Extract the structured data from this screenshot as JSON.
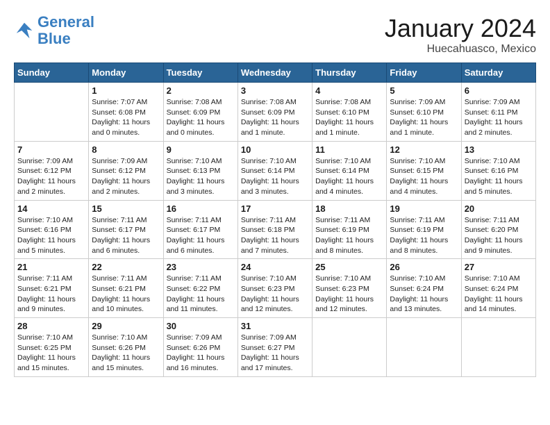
{
  "header": {
    "logo_line1": "General",
    "logo_line2": "Blue",
    "month": "January 2024",
    "location": "Huecahuasco, Mexico"
  },
  "weekdays": [
    "Sunday",
    "Monday",
    "Tuesday",
    "Wednesday",
    "Thursday",
    "Friday",
    "Saturday"
  ],
  "weeks": [
    [
      {
        "day": "",
        "text": ""
      },
      {
        "day": "1",
        "text": "Sunrise: 7:07 AM\nSunset: 6:08 PM\nDaylight: 11 hours\nand 0 minutes."
      },
      {
        "day": "2",
        "text": "Sunrise: 7:08 AM\nSunset: 6:09 PM\nDaylight: 11 hours\nand 0 minutes."
      },
      {
        "day": "3",
        "text": "Sunrise: 7:08 AM\nSunset: 6:09 PM\nDaylight: 11 hours\nand 1 minute."
      },
      {
        "day": "4",
        "text": "Sunrise: 7:08 AM\nSunset: 6:10 PM\nDaylight: 11 hours\nand 1 minute."
      },
      {
        "day": "5",
        "text": "Sunrise: 7:09 AM\nSunset: 6:10 PM\nDaylight: 11 hours\nand 1 minute."
      },
      {
        "day": "6",
        "text": "Sunrise: 7:09 AM\nSunset: 6:11 PM\nDaylight: 11 hours\nand 2 minutes."
      }
    ],
    [
      {
        "day": "7",
        "text": "Sunrise: 7:09 AM\nSunset: 6:12 PM\nDaylight: 11 hours\nand 2 minutes."
      },
      {
        "day": "8",
        "text": "Sunrise: 7:09 AM\nSunset: 6:12 PM\nDaylight: 11 hours\nand 2 minutes."
      },
      {
        "day": "9",
        "text": "Sunrise: 7:10 AM\nSunset: 6:13 PM\nDaylight: 11 hours\nand 3 minutes."
      },
      {
        "day": "10",
        "text": "Sunrise: 7:10 AM\nSunset: 6:14 PM\nDaylight: 11 hours\nand 3 minutes."
      },
      {
        "day": "11",
        "text": "Sunrise: 7:10 AM\nSunset: 6:14 PM\nDaylight: 11 hours\nand 4 minutes."
      },
      {
        "day": "12",
        "text": "Sunrise: 7:10 AM\nSunset: 6:15 PM\nDaylight: 11 hours\nand 4 minutes."
      },
      {
        "day": "13",
        "text": "Sunrise: 7:10 AM\nSunset: 6:16 PM\nDaylight: 11 hours\nand 5 minutes."
      }
    ],
    [
      {
        "day": "14",
        "text": "Sunrise: 7:10 AM\nSunset: 6:16 PM\nDaylight: 11 hours\nand 5 minutes."
      },
      {
        "day": "15",
        "text": "Sunrise: 7:11 AM\nSunset: 6:17 PM\nDaylight: 11 hours\nand 6 minutes."
      },
      {
        "day": "16",
        "text": "Sunrise: 7:11 AM\nSunset: 6:17 PM\nDaylight: 11 hours\nand 6 minutes."
      },
      {
        "day": "17",
        "text": "Sunrise: 7:11 AM\nSunset: 6:18 PM\nDaylight: 11 hours\nand 7 minutes."
      },
      {
        "day": "18",
        "text": "Sunrise: 7:11 AM\nSunset: 6:19 PM\nDaylight: 11 hours\nand 8 minutes."
      },
      {
        "day": "19",
        "text": "Sunrise: 7:11 AM\nSunset: 6:19 PM\nDaylight: 11 hours\nand 8 minutes."
      },
      {
        "day": "20",
        "text": "Sunrise: 7:11 AM\nSunset: 6:20 PM\nDaylight: 11 hours\nand 9 minutes."
      }
    ],
    [
      {
        "day": "21",
        "text": "Sunrise: 7:11 AM\nSunset: 6:21 PM\nDaylight: 11 hours\nand 9 minutes."
      },
      {
        "day": "22",
        "text": "Sunrise: 7:11 AM\nSunset: 6:21 PM\nDaylight: 11 hours\nand 10 minutes."
      },
      {
        "day": "23",
        "text": "Sunrise: 7:11 AM\nSunset: 6:22 PM\nDaylight: 11 hours\nand 11 minutes."
      },
      {
        "day": "24",
        "text": "Sunrise: 7:10 AM\nSunset: 6:23 PM\nDaylight: 11 hours\nand 12 minutes."
      },
      {
        "day": "25",
        "text": "Sunrise: 7:10 AM\nSunset: 6:23 PM\nDaylight: 11 hours\nand 12 minutes."
      },
      {
        "day": "26",
        "text": "Sunrise: 7:10 AM\nSunset: 6:24 PM\nDaylight: 11 hours\nand 13 minutes."
      },
      {
        "day": "27",
        "text": "Sunrise: 7:10 AM\nSunset: 6:24 PM\nDaylight: 11 hours\nand 14 minutes."
      }
    ],
    [
      {
        "day": "28",
        "text": "Sunrise: 7:10 AM\nSunset: 6:25 PM\nDaylight: 11 hours\nand 15 minutes."
      },
      {
        "day": "29",
        "text": "Sunrise: 7:10 AM\nSunset: 6:26 PM\nDaylight: 11 hours\nand 15 minutes."
      },
      {
        "day": "30",
        "text": "Sunrise: 7:09 AM\nSunset: 6:26 PM\nDaylight: 11 hours\nand 16 minutes."
      },
      {
        "day": "31",
        "text": "Sunrise: 7:09 AM\nSunset: 6:27 PM\nDaylight: 11 hours\nand 17 minutes."
      },
      {
        "day": "",
        "text": ""
      },
      {
        "day": "",
        "text": ""
      },
      {
        "day": "",
        "text": ""
      }
    ]
  ]
}
